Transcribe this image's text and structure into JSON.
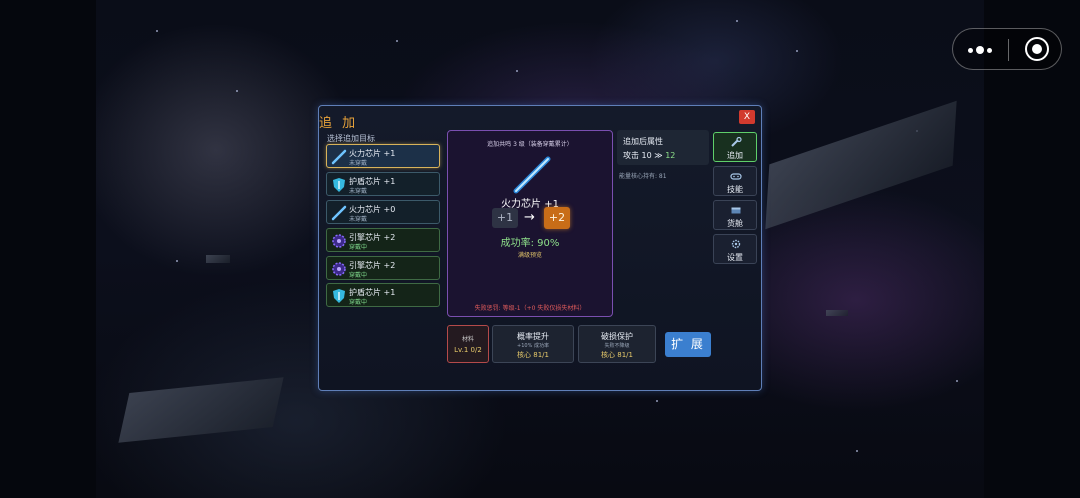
{
  "dialog": {
    "title": "追 加",
    "close_label": "X",
    "select_label": "选择追加目标"
  },
  "items": [
    {
      "name": "火力芯片 +1",
      "status": "未穿戴",
      "icon": "blue-sword-icon",
      "state": "selected"
    },
    {
      "name": "护盾芯片 +1",
      "status": "未穿戴",
      "icon": "cyan-shield-icon",
      "state": "normal"
    },
    {
      "name": "火力芯片 +0",
      "status": "未穿戴",
      "icon": "blue-sword-icon",
      "state": "normal"
    },
    {
      "name": "引擎芯片 +2",
      "status": "穿戴中",
      "icon": "purple-gear-icon",
      "state": "equipped"
    },
    {
      "name": "引擎芯片 +2",
      "status": "穿戴中",
      "icon": "purple-gear-icon",
      "state": "equipped"
    },
    {
      "name": "护盾芯片 +1",
      "status": "穿戴中",
      "icon": "cyan-shield-icon",
      "state": "equipped"
    }
  ],
  "center": {
    "header": "追加共鸣 3 级（装备穿戴累计）",
    "chip_name": "火力芯片 +1",
    "level_from": "+1",
    "arrow": "→",
    "level_to": "+2",
    "success_rate": "成功率: 90%",
    "preview": "满级预览",
    "fail_note": "失败惩罚: 等级-1（+0 失败仅损失材料）"
  },
  "attributes": {
    "title": "追加后属性",
    "stat_label": "攻击",
    "stat_from": "10",
    "stat_arrow": "≫",
    "stat_to": "12",
    "core_line": "能量核心持有: 81"
  },
  "side_menu": [
    {
      "label": "追加",
      "icon": "wrench-icon",
      "active": true
    },
    {
      "label": "技能",
      "icon": "gamepad-icon",
      "active": false
    },
    {
      "label": "货舱",
      "icon": "cargo-icon",
      "active": false
    },
    {
      "label": "设置",
      "icon": "settings-icon",
      "active": false
    }
  ],
  "material": {
    "label": "材料",
    "value": "Lv.1 0/2"
  },
  "options": [
    {
      "title": "概率提升",
      "desc": "+10% 成功率",
      "cost": "核心 81/1"
    },
    {
      "title": "破损保护",
      "desc": "失败不降级",
      "cost": "核心 81/1"
    }
  ],
  "expand_button": "扩 展",
  "colors": {
    "accent_orange": "#e7a23a",
    "frame_blue": "#5f7fb8",
    "success_green": "#8ee08a",
    "warning_red": "#e25c5c",
    "level_orange": "#c86d18"
  }
}
